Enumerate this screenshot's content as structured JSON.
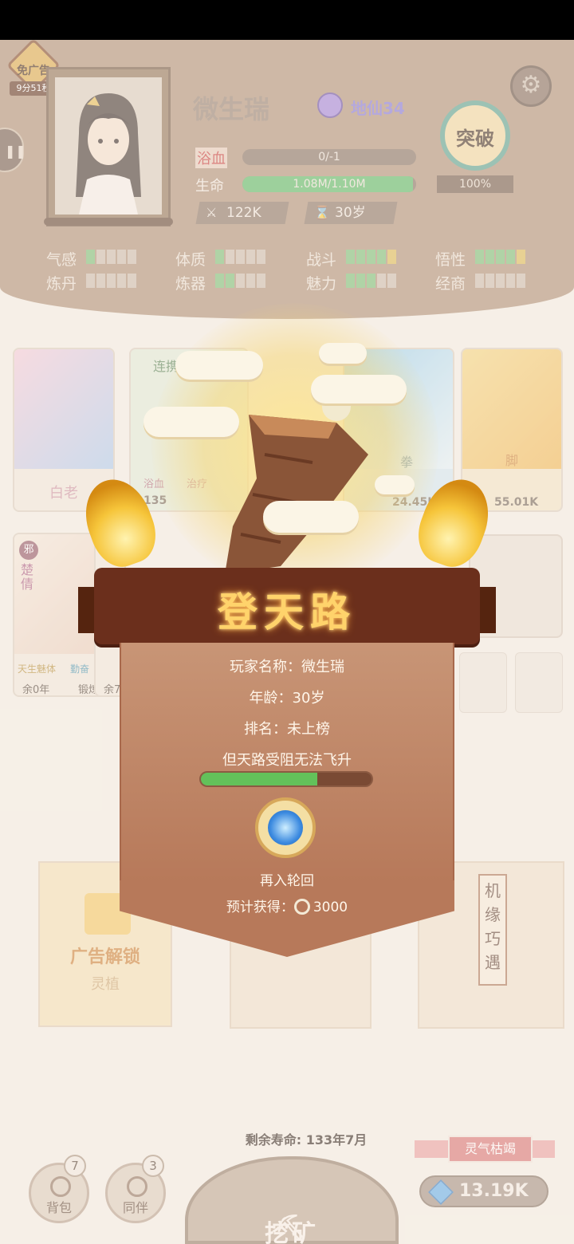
{
  "status": {},
  "no_ad": {
    "label": "免广告",
    "timer": "9分51秒"
  },
  "character": {
    "name": "微生瑞",
    "realm": "地仙34",
    "bath_label": "浴血",
    "bath_value": "0/-1",
    "life_label": "生命",
    "life_value": "1.08M/1.10M",
    "life_fraction": 0.98,
    "power": "122K",
    "age": "30岁",
    "power_icon": "crossed-swords-icon",
    "age_icon": "hourglass-icon"
  },
  "breakthrough": {
    "label": "突破",
    "percent": "100%"
  },
  "attributes": [
    {
      "label": "气感",
      "filled": 1,
      "total": 5
    },
    {
      "label": "体质",
      "filled": 1,
      "total": 5
    },
    {
      "label": "战斗",
      "filled": 5,
      "total": 5
    },
    {
      "label": "悟性",
      "filled": 5,
      "total": 5
    },
    {
      "label": "炼丹",
      "filled": 0,
      "total": 5
    },
    {
      "label": "炼器",
      "filled": 2,
      "total": 5
    },
    {
      "label": "魅力",
      "filled": 3,
      "total": 5
    },
    {
      "label": "经商",
      "filled": 0,
      "total": 5
    }
  ],
  "cards": {
    "c1_name": "白老",
    "c2_title": "连携",
    "c2_tag1": "浴血",
    "c2_tag2": "治疗",
    "c2_stat": "135",
    "c4_name": "拳",
    "c4_stat": "24.45K",
    "c5_name": "脚",
    "c5_stat": "55.01K",
    "c6_tag": "邪",
    "c6_name": "楚倩",
    "c6_trait1": "天生魅体",
    "c6_trait2": "勤奋",
    "c6_left1": "余0年",
    "c6_left2": "锻炼",
    "c7_left": "余7"
  },
  "packs": {
    "ad_unlock": "广告解锁",
    "ad_sub": "灵植",
    "fortune": "机缘巧遇"
  },
  "modal": {
    "title": "登天路",
    "player_line": "玩家名称：微生瑞",
    "age_line": "年龄：30岁",
    "rank_line": "排名：未上榜",
    "blocked_line": "但天路受阻无法飞升",
    "progress_fraction": 0.68,
    "reincarnate_label": "再入轮回",
    "reward_prefix": "预计获得：",
    "reward_value": "3000"
  },
  "bottom": {
    "lifespan": "剩余寿命: 133年7月",
    "bag_label": "背包",
    "bag_badge": "7",
    "partner_label": "同伴",
    "partner_badge": "3",
    "mine_label": "挖矿",
    "drought_label": "灵气枯竭",
    "crystals": "13.19K"
  },
  "colors": {
    "accent_green": "#51b35a",
    "realm_purple": "#7b6bd1",
    "banner_gold": "#ffd36b"
  }
}
